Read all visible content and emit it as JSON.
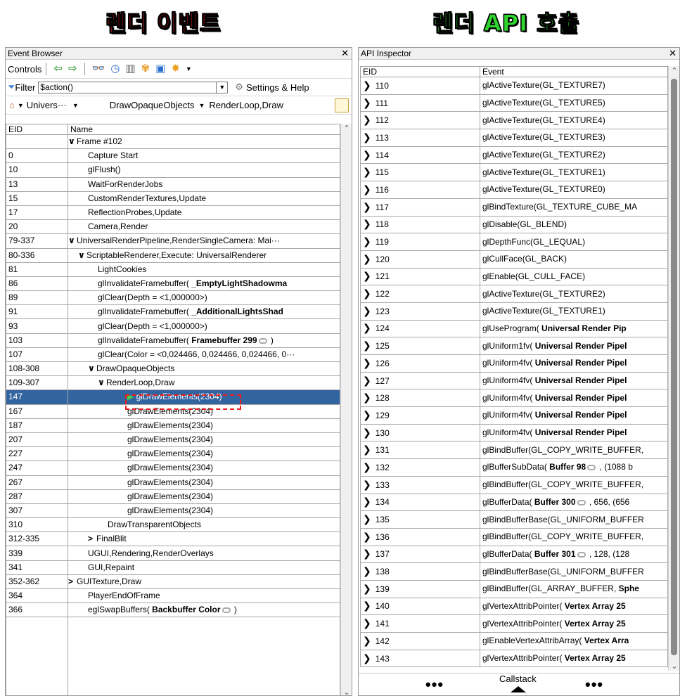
{
  "headings": {
    "left": "렌더 이벤트",
    "right": "렌더 API 호출"
  },
  "colors": {
    "left_heading": "#e8101c",
    "right_heading": "#2ed52e",
    "selection": "#3264a0",
    "highlight": "#ee1c1c"
  },
  "event_browser": {
    "title": "Event Browser",
    "toolbar": {
      "controls_label": "Controls",
      "icons": [
        "back-arrow-icon",
        "forward-arrow-icon",
        "find-icon",
        "clock-icon",
        "stats-icon",
        "colorize-icon",
        "save-icon",
        "bookmark-icon"
      ]
    },
    "filter": {
      "label": "Filter",
      "value": "$action()",
      "settings_label": "Settings & Help"
    },
    "breadcrumb": {
      "home": "Univers···",
      "level2": "DrawOpaqueObjects",
      "level3": "RenderLoop,Draw"
    },
    "columns": {
      "eid": "EID",
      "name": "Name"
    },
    "rows": [
      {
        "eid": "",
        "name": "Frame #102",
        "chev": "∨"
      },
      {
        "eid": "0",
        "name": "Capture Start"
      },
      {
        "eid": "10",
        "name": "glFlush()"
      },
      {
        "eid": "13",
        "name": "WaitForRenderJobs"
      },
      {
        "eid": "15",
        "name": "CustomRenderTextures,Update"
      },
      {
        "eid": "17",
        "name": "ReflectionProbes,Update"
      },
      {
        "eid": "20",
        "name": "Camera,Render"
      },
      {
        "eid": "79-337",
        "name": "UniversalRenderPipeline,RenderSingleCamera: Mai···",
        "chev": "∨"
      },
      {
        "eid": "80-336",
        "name": "ScriptableRenderer,Execute: UniversalRenderer",
        "chev": "∨"
      },
      {
        "eid": "81",
        "name": "LightCookies"
      },
      {
        "eid": "86",
        "name": "glInvalidateFramebuffer( ",
        "bold": "_EmptyLightShadowma"
      },
      {
        "eid": "89",
        "name": "glClear(Depth = <1,000000>)"
      },
      {
        "eid": "91",
        "name": "glInvalidateFramebuffer( ",
        "bold": "_AdditionalLightsShad"
      },
      {
        "eid": "93",
        "name": "glClear(Depth = <1,000000>)"
      },
      {
        "eid": "103",
        "name": "glInvalidateFramebuffer( ",
        "bold": "Framebuffer 299",
        "tail": " )"
      },
      {
        "eid": "107",
        "name": "glClear(Color = <0,024466, 0,024466, 0,024466, 0···"
      },
      {
        "eid": "108-308",
        "name": "DrawOpaqueObjects",
        "chev": "∨"
      },
      {
        "eid": "109-307",
        "name": "RenderLoop,Draw",
        "chev": "∨"
      },
      {
        "eid": "147",
        "name": "glDrawElements(2304)"
      },
      {
        "eid": "167",
        "name": "glDrawElements(2304)"
      },
      {
        "eid": "187",
        "name": "glDrawElements(2304)"
      },
      {
        "eid": "207",
        "name": "glDrawElements(2304)"
      },
      {
        "eid": "227",
        "name": "glDrawElements(2304)"
      },
      {
        "eid": "247",
        "name": "glDrawElements(2304)"
      },
      {
        "eid": "267",
        "name": "glDrawElements(2304)"
      },
      {
        "eid": "287",
        "name": "glDrawElements(2304)"
      },
      {
        "eid": "307",
        "name": "glDrawElements(2304)"
      },
      {
        "eid": "310",
        "name": "DrawTransparentObjects"
      },
      {
        "eid": "312-335",
        "name": "FinalBlit",
        "chev": ">"
      },
      {
        "eid": "339",
        "name": "UGUI,Rendering,RenderOverlays"
      },
      {
        "eid": "341",
        "name": "GUI,Repaint"
      },
      {
        "eid": "352-362",
        "name": "GUITexture,Draw",
        "chev": ">"
      },
      {
        "eid": "364",
        "name": "PlayerEndOfFrame"
      },
      {
        "eid": "366",
        "name": "eglSwapBuffers( ",
        "bold": "Backbuffer Color",
        "tail": " )"
      }
    ]
  },
  "api_inspector": {
    "title": "API Inspector",
    "columns": {
      "eid": "EID",
      "event": "Event"
    },
    "rows": [
      {
        "eid": "110",
        "event": "glActiveTexture(GL_TEXTURE7)"
      },
      {
        "eid": "111",
        "event": "glActiveTexture(GL_TEXTURE5)"
      },
      {
        "eid": "112",
        "event": "glActiveTexture(GL_TEXTURE4)"
      },
      {
        "eid": "113",
        "event": "glActiveTexture(GL_TEXTURE3)"
      },
      {
        "eid": "114",
        "event": "glActiveTexture(GL_TEXTURE2)"
      },
      {
        "eid": "115",
        "event": "glActiveTexture(GL_TEXTURE1)"
      },
      {
        "eid": "116",
        "event": "glActiveTexture(GL_TEXTURE0)"
      },
      {
        "eid": "117",
        "event": "glBindTexture(GL_TEXTURE_CUBE_MA"
      },
      {
        "eid": "118",
        "event": "glDisable(GL_BLEND)"
      },
      {
        "eid": "119",
        "event": "glDepthFunc(GL_LEQUAL)"
      },
      {
        "eid": "120",
        "event": "glCullFace(GL_BACK)"
      },
      {
        "eid": "121",
        "event": "glEnable(GL_CULL_FACE)"
      },
      {
        "eid": "122",
        "event": "glActiveTexture(GL_TEXTURE2)"
      },
      {
        "eid": "123",
        "event": "glActiveTexture(GL_TEXTURE1)"
      },
      {
        "eid": "124",
        "event": "glUseProgram(",
        "bold": " Universal Render Pip"
      },
      {
        "eid": "125",
        "event": "glUniform1fv(",
        "bold": " Universal Render Pipel"
      },
      {
        "eid": "126",
        "event": "glUniform4fv(",
        "bold": " Universal Render Pipel"
      },
      {
        "eid": "127",
        "event": "glUniform4fv(",
        "bold": " Universal Render Pipel"
      },
      {
        "eid": "128",
        "event": "glUniform4fv(",
        "bold": " Universal Render Pipel"
      },
      {
        "eid": "129",
        "event": "glUniform4fv(",
        "bold": " Universal Render Pipel"
      },
      {
        "eid": "130",
        "event": "glUniform4fv(",
        "bold": " Universal Render Pipel"
      },
      {
        "eid": "131",
        "event": "glBindBuffer(GL_COPY_WRITE_BUFFER,"
      },
      {
        "eid": "132",
        "event": "glBufferSubData(",
        "bold": " Buffer 98",
        "tail": " , (1088 b"
      },
      {
        "eid": "133",
        "event": "glBindBuffer(GL_COPY_WRITE_BUFFER,"
      },
      {
        "eid": "134",
        "event": "glBufferData(",
        "bold": " Buffer 300",
        "tail": " , 656, (656"
      },
      {
        "eid": "135",
        "event": "glBindBufferBase(GL_UNIFORM_BUFFER"
      },
      {
        "eid": "136",
        "event": "glBindBuffer(GL_COPY_WRITE_BUFFER,"
      },
      {
        "eid": "137",
        "event": "glBufferData(",
        "bold": " Buffer 301",
        "tail": " , 128, (128"
      },
      {
        "eid": "138",
        "event": "glBindBufferBase(GL_UNIFORM_BUFFER"
      },
      {
        "eid": "139",
        "event": "glBindBuffer(GL_ARRAY_BUFFER,",
        "bold": "  Sphe"
      },
      {
        "eid": "140",
        "event": "glVertexAttribPointer(",
        "bold": " Vertex Array 25"
      },
      {
        "eid": "141",
        "event": "glVertexAttribPointer(",
        "bold": " Vertex Array 25"
      },
      {
        "eid": "142",
        "event": "glEnableVertexAttribArray(",
        "bold": " Vertex Arra"
      },
      {
        "eid": "143",
        "event": "glVertexAttribPointer(",
        "bold": " Vertex Array 25"
      }
    ],
    "bottom": {
      "callstack_label": "Callstack",
      "dots_left": "•••",
      "dots_right": "•••"
    }
  }
}
